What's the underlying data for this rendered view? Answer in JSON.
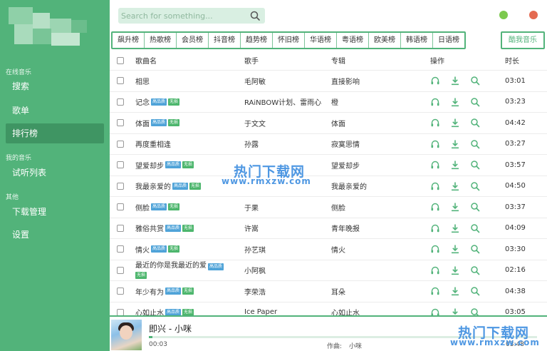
{
  "colors": {
    "accent": "#52b37a",
    "sidebar_active": "#3f9563",
    "badge_hq": "#4fa3d8",
    "badge_lossless": "#4db66d",
    "dot_green": "#7cc94e",
    "dot_red": "#e46a51",
    "watermark": "#3f8fe0"
  },
  "sidebar": {
    "sections": [
      {
        "title": "在线音乐",
        "items": [
          {
            "label": "搜索"
          },
          {
            "label": "歌单"
          },
          {
            "label": "排行榜",
            "active": true
          }
        ]
      },
      {
        "title": "我的音乐",
        "items": [
          {
            "label": "试听列表"
          }
        ]
      },
      {
        "title": "其他",
        "items": [
          {
            "label": "下载管理"
          },
          {
            "label": "设置"
          }
        ]
      }
    ]
  },
  "search": {
    "placeholder": "Search for something..."
  },
  "tabs": [
    "飙升榜",
    "热歌榜",
    "会员榜",
    "抖音榜",
    "趋势榜",
    "怀旧榜",
    "华语榜",
    "粤语榜",
    "欧美榜",
    "韩语榜",
    "日语榜"
  ],
  "source_tab": "酷我音乐",
  "table": {
    "headers": {
      "name": "歌曲名",
      "artist": "歌手",
      "album": "专辑",
      "ops": "操作",
      "time": "时长"
    },
    "badges": {
      "hq": "高品质",
      "lossless": "无损"
    },
    "rows": [
      {
        "name": "相思",
        "artist": "毛阿敏",
        "album": "直接影响",
        "time": "03:01"
      },
      {
        "name": "记念",
        "artist": "RAiNBOW计划、雷雨心",
        "album": "橙",
        "time": "03:23"
      },
      {
        "name": "体面",
        "artist": "于文文",
        "album": "体面",
        "time": "04:42"
      },
      {
        "name": "再度重相逢",
        "artist": "孙露",
        "album": "寂寞思情",
        "time": "03:27"
      },
      {
        "name": "望爱却步",
        "artist": "",
        "album": "望爱却步",
        "time": "03:57"
      },
      {
        "name": "我最亲爱的",
        "artist": "",
        "album": "我最亲爱的",
        "time": "04:50"
      },
      {
        "name": "侧脸",
        "artist": "于果",
        "album": "侧脸",
        "time": "03:37"
      },
      {
        "name": "雅俗共赏",
        "artist": "许嵩",
        "album": "青年晚报",
        "time": "04:09"
      },
      {
        "name": "情火",
        "artist": "孙艺琪",
        "album": "情火",
        "time": "03:30"
      },
      {
        "name": "最近的你是我最近的爱",
        "artist": "小阿枫",
        "album": "",
        "time": "02:16"
      },
      {
        "name": "年少有为",
        "artist": "李荣浩",
        "album": "耳朵",
        "time": "04:38"
      },
      {
        "name": "心如止水",
        "artist": "Ice Paper",
        "album": "心如止水",
        "time": "03:05"
      }
    ],
    "icons": [
      "headphones-icon",
      "download-icon",
      "search-icon"
    ]
  },
  "player": {
    "title": "即兴 - 小咪",
    "current_time": "00:03",
    "composer_label": "作曲:",
    "composer": "小咪",
    "end_time": "03:48",
    "progress": 0.01
  },
  "watermark": {
    "line1": "热门下载网",
    "line2": "www.rmxzw.com"
  }
}
